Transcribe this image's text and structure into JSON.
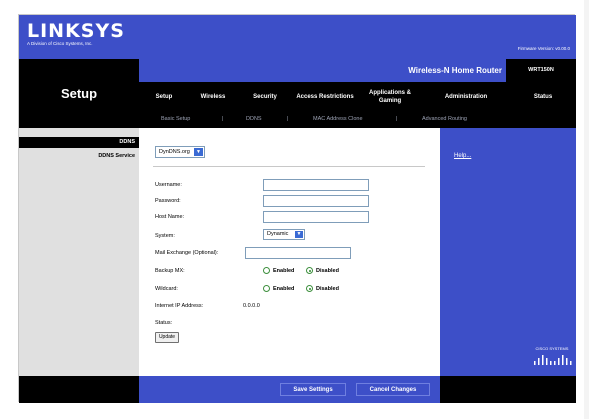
{
  "header": {
    "logo": "LINKSYS",
    "logo_sub": "A Division of Cisco Systems, Inc.",
    "firmware": "Firmware Version: v0.00.0",
    "section_title": "Setup",
    "product_name": "Wireless-N Home Router",
    "model": "WRT150N"
  },
  "tabs": [
    {
      "label": "Setup",
      "active": true
    },
    {
      "label": "Wireless",
      "active": false
    },
    {
      "label": "Security",
      "active": false
    },
    {
      "label": "Access Restrictions",
      "active": false
    },
    {
      "label": "Applications & Gaming",
      "active": false
    },
    {
      "label": "Administration",
      "active": false
    },
    {
      "label": "Status",
      "active": false
    }
  ],
  "subtabs": [
    "Basic Setup",
    "DDNS",
    "MAC Address Clone",
    "Advanced Routing"
  ],
  "separator": "|",
  "left": {
    "heading": "DDNS",
    "label": "DDNS Service"
  },
  "form": {
    "service_value": "DynDNS.org",
    "username_label": "Username:",
    "password_label": "Password:",
    "hostname_label": "Host Name:",
    "system_label": "System:",
    "system_value": "Dynamic",
    "mx_label": "Mail Exchange (Optional):",
    "backup_label": "Backup MX:",
    "wildcard_label": "Wildcard:",
    "enabled_label": "Enabled",
    "disabled_label": "Disabled",
    "backup_selected": "Disabled",
    "wildcard_selected": "Disabled",
    "ip_label": "Internet IP Address:",
    "ip_value": "0.0.0.0",
    "status_label": "Status:",
    "update_label": "Update"
  },
  "help": {
    "label": "Help..."
  },
  "brand": {
    "cisco": "CISCO SYSTEMS"
  },
  "footer": {
    "save_label": "Save Settings",
    "cancel_label": "Cancel Changes"
  },
  "colors": {
    "brand_blue": "#3d4fc8",
    "black": "#000000",
    "grey_panel": "#e0e0e0"
  }
}
